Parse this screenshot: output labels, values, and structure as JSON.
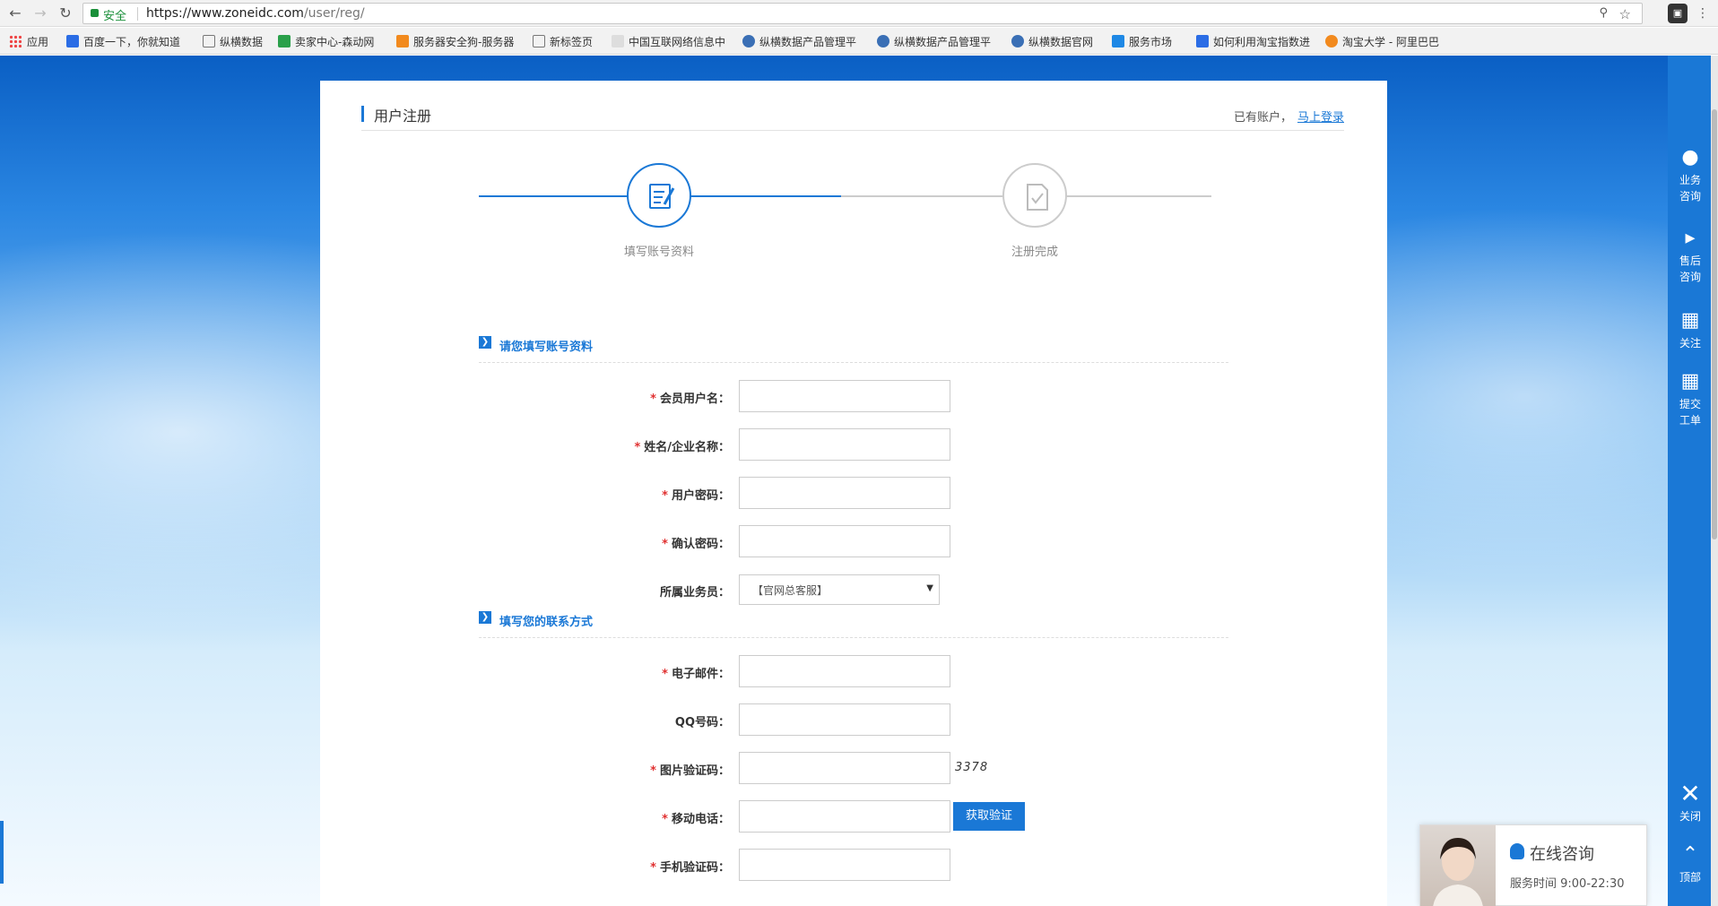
{
  "browser": {
    "secure_label": "安全",
    "url_host": "https://www.zoneidc.com",
    "url_path": "/user/reg/",
    "bookmarks": [
      "应用",
      "百度一下，你就知道",
      "纵横数据",
      "卖家中心-森动网",
      "服务器安全狗-服务器",
      "新标签页",
      "中国互联网络信息中",
      "纵横数据产品管理平",
      "纵横数据产品管理平",
      "纵横数据官网",
      "服务市场",
      "如何利用淘宝指数进",
      "淘宝大学 - 阿里巴巴"
    ]
  },
  "header": {
    "title": "用户注册",
    "has_account": "已有账户，",
    "login_link": "马上登录"
  },
  "steps": [
    {
      "label": "填写账号资料",
      "active": true
    },
    {
      "label": "注册完成",
      "active": false
    }
  ],
  "sections": {
    "account": "请您填写账号资料",
    "contact": "填写您的联系方式"
  },
  "fields": {
    "username": "会员用户名：",
    "realname": "姓名/企业名称：",
    "password": "用户密码：",
    "confirm": "确认密码：",
    "salesman": "所属业务员：",
    "salesman_value": "【官网总客服】",
    "email": "电子邮件：",
    "qq": "QQ号码：",
    "captcha": "图片验证码：",
    "captcha_value": "3378",
    "mobile": "移动电话：",
    "get_code": "获取验证",
    "sms_code": "手机验证码："
  },
  "sidebar": {
    "items": [
      "业务咨询",
      "售后咨询",
      "关注",
      "提交工单",
      "关闭",
      "顶部"
    ]
  },
  "chat": {
    "title": "在线咨询",
    "hours": "服务时间 9:00-22:30"
  },
  "colors": {
    "accent": "#1a78d6",
    "required": "#e03030"
  }
}
